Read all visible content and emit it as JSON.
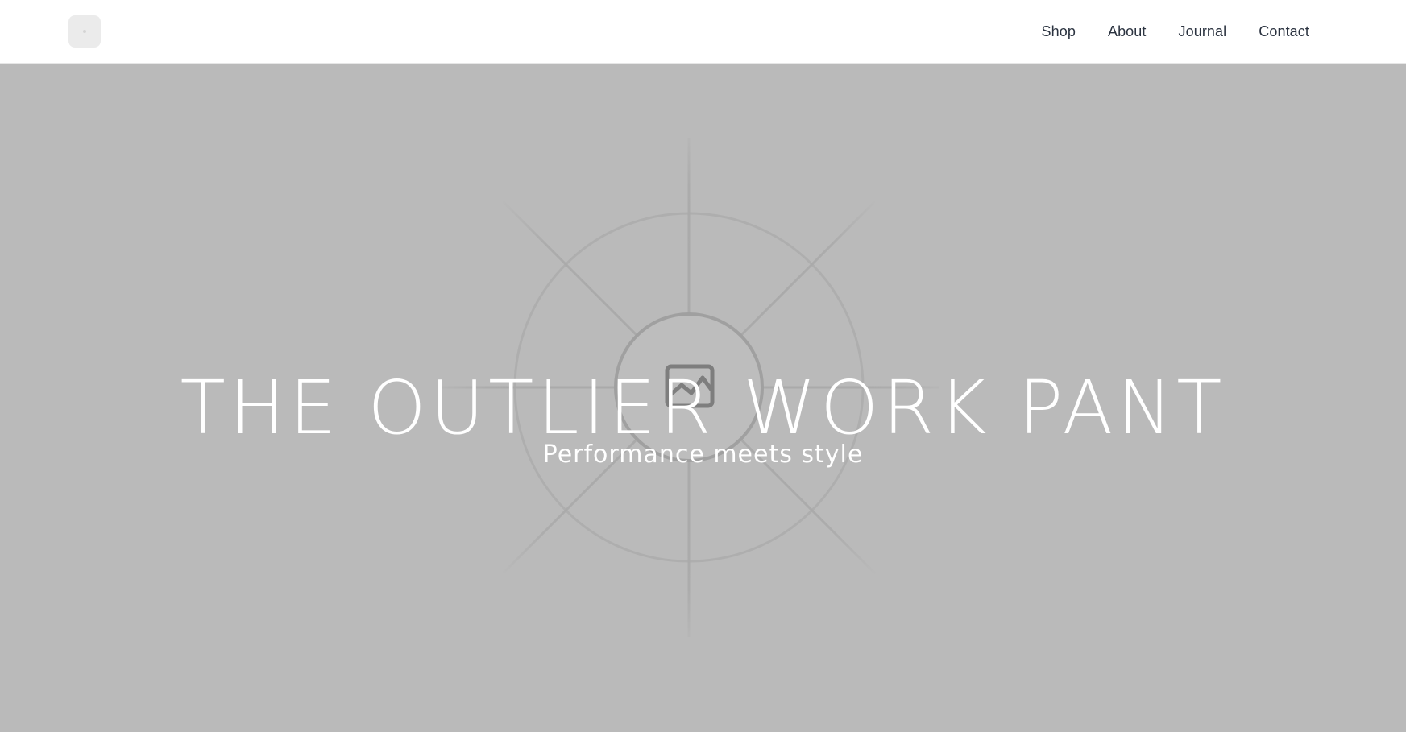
{
  "header": {
    "logo_icon": "logo-placeholder-icon",
    "nav": {
      "items": [
        {
          "label": "Shop"
        },
        {
          "label": "About"
        },
        {
          "label": "Journal"
        },
        {
          "label": "Contact"
        }
      ]
    }
  },
  "hero": {
    "title": "THE OUTLIER WORK PANT",
    "subtitle": "Performance meets style",
    "background_color": "#bababa",
    "image_icon": "image-placeholder-icon"
  },
  "colors": {
    "nav_text": "#2b3340",
    "hero_text": "#ffffff",
    "placeholder_lines": "#a8a8a8",
    "placeholder_icon": "#7e7e7e"
  }
}
